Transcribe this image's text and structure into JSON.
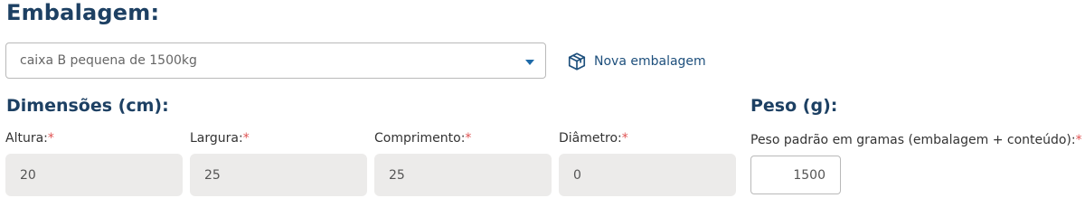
{
  "packaging": {
    "title": "Embalagem:",
    "select_value": "caixa B pequena de 1500kg",
    "new_button_label": "Nova embalagem"
  },
  "dimensions": {
    "title": "Dimensões (cm):",
    "fields": [
      {
        "label": "Altura:",
        "value": "20"
      },
      {
        "label": "Largura:",
        "value": "25"
      },
      {
        "label": "Comprimento:",
        "value": "25"
      },
      {
        "label": "Diâmetro:",
        "value": "0"
      }
    ],
    "required_mark": "*"
  },
  "weight": {
    "title": "Peso (g):",
    "label": "Peso padrão em gramas (embalagem + conteúdo):",
    "value": "1500"
  },
  "colors": {
    "heading": "#1d4063",
    "link": "#1d4f7c",
    "required": "#e05252",
    "input_bg": "#ecebea"
  },
  "icons": {
    "select_caret": "caret-down-icon",
    "new_packaging": "box-icon"
  }
}
